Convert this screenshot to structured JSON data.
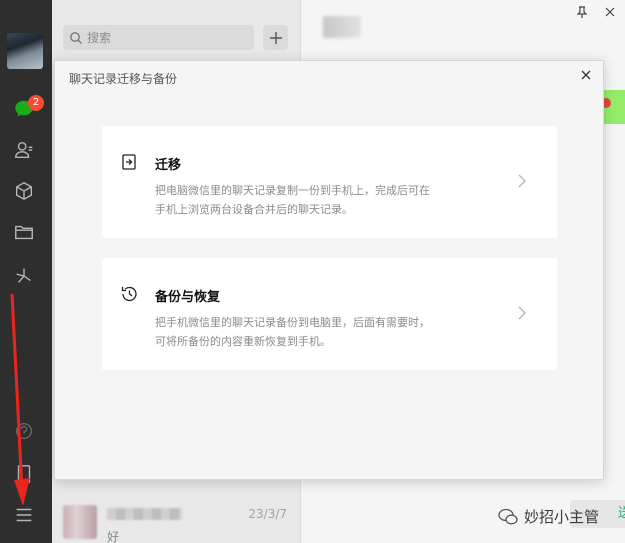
{
  "nav": {
    "unread_badge": "2",
    "icons": [
      "chat-bubble-icon",
      "contacts-icon",
      "favorites-cube-icon",
      "folder-icon",
      "moments-icon",
      "miniprogram-icon",
      "phone-icon",
      "menu-icon"
    ]
  },
  "chat_list": {
    "search_placeholder": "搜索",
    "add_label": "+",
    "row": {
      "time": "23/3/7",
      "preview": "好"
    }
  },
  "main": {
    "watermark": "妙招小主管",
    "send_label": "送信"
  },
  "dialog": {
    "title": "聊天记录迁移与备份",
    "cards": [
      {
        "title": "迁移",
        "desc_line1": "把电脑微信里的聊天记录复制一份到手机上，完成后可在",
        "desc_line2": "手机上浏览两台设备合并后的聊天记录。"
      },
      {
        "title": "备份与恢复",
        "desc_line1": "把手机微信里的聊天记录备份到电脑里，后面有需要时，",
        "desc_line2": "可将所备份的内容重新恢复到手机。"
      }
    ]
  },
  "colors": {
    "nav_bg": "#2e2e2e",
    "accent_green": "#07c160",
    "badge_red": "#f74c31",
    "annotation_red": "#e8261e"
  }
}
